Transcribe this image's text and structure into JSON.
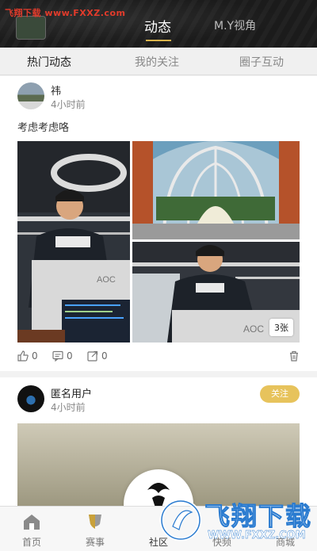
{
  "watermark": "飞翔下载 www.FXXZ.com",
  "header": {
    "tabs": [
      {
        "label": "动态",
        "active": true
      },
      {
        "label": "M.Y视角",
        "active": false
      }
    ],
    "accent": "#d8b24a"
  },
  "subtabs": [
    {
      "label": "热门动态",
      "active": true
    },
    {
      "label": "我的关注",
      "active": false
    },
    {
      "label": "圈子互动",
      "active": false
    }
  ],
  "posts": [
    {
      "user": "祎",
      "time": "4小时前",
      "text": "考虑考虑咯",
      "image_count": "3张",
      "likes": "0",
      "comments": "0",
      "shares": "0"
    },
    {
      "user": "匿名用户",
      "time": "4小时前",
      "follow_label": "关注"
    }
  ],
  "bottom_nav": [
    {
      "label": "首页",
      "icon": "home-icon"
    },
    {
      "label": "赛事",
      "icon": "trophy-icon"
    },
    {
      "label": "社区",
      "icon": "community-icon",
      "active": true
    },
    {
      "label": "快频",
      "icon": "video-icon"
    },
    {
      "label": "商城",
      "icon": "shop-icon"
    }
  ],
  "brand": {
    "name": "飞翔下载",
    "url": "WWW.FXXZ.COM"
  }
}
